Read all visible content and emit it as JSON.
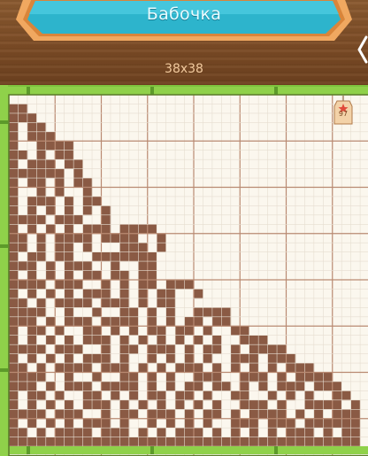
{
  "header": {
    "title": "Бабочка",
    "size_label": "38x38"
  },
  "badge": {
    "value": "97",
    "icon": "star-icon"
  },
  "colors": {
    "filled": "#8a5a44",
    "cell_bg": "#fbf7ee",
    "grid_thin": "#e6ddd0",
    "grid_thick": "#b98a72",
    "bamboo": "#7ec43e",
    "plate": "#2db4cc",
    "plate_border": "#f0a860"
  },
  "puzzle": {
    "cols": 38,
    "rows": 38,
    "visible_cols": 39,
    "visible_rows": 39,
    "filled_rows": [
      "......................................",
      "##....................................",
      "###...................................",
      "#.##..................................",
      "#.###.................................",
      "#..####...............................",
      "##.#.##...............................",
      "#.###.##..............................",
      "######.#..............................",
      "#.##.#.##.............................",
      "#..#.#..#.............................",
      "#.###.#.##............................",
      "#.#.#.#.#.#...........................",
      "####.###..#...........................",
      "#.#.#.#.###.####......................",
      "##.#.####.####..#.....................",
      "##.#.##.#...###.#.....................",
      "#.##.##..#######......................",
      "###.#.###..#..##......................",
      "#.#.#.#.##.##.##......................",
      "####.###..#.#.##.###..................",
      "#.#.#.#.###.#.#.##..#.................",
      "##.#.####.###.#.##....................",
      "####..#..#..##.#.#..####..............",
      "###.#.###.####.#.#.##.##..............",
      "#.##.#..##.#.#.##.##.#..##............",
      "#.#.#.#.###.#.#.#.#.#.#..###..........",
      "####.###..#.##.###.#.##.#.####........",
      "#.#.#.#.###.#..#.#.#.#..###.###.......",
      "##.#.####.###.#.#.###.#.#.#.#.###.....",
      "####..#..#..##.#.#..###..###.#.####...",
      "###.#.###.####.#.#.##.##.#.#.###.###..",
      "#.##.#..##.#.#.##.##.#..##..#.#.#..##.",
      "#.#.#.#.###.#.#.#.#.#.#..###.#..####.#",
      "####.###..#.##.###.#.##.#.####.#.#.###",
      "#.#.#.#.###.#..#.#.#.#..###.###.######",
      "##.#.####.###.#.#.###.#.#.#.#.###.#.##",
      "######################################"
    ]
  }
}
